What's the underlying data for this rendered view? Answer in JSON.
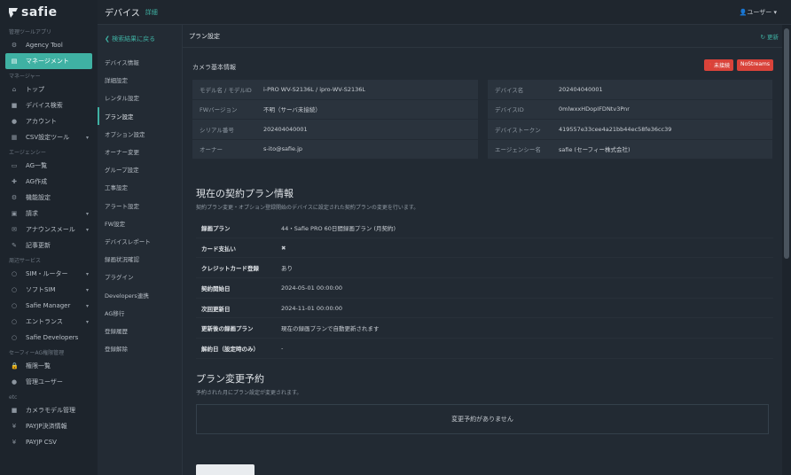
{
  "app": {
    "logo": "safie"
  },
  "sidebar": {
    "sections": [
      {
        "title": "管理ツールアプリ",
        "items": [
          {
            "label": "Agency Tool",
            "icon": "agency-icon",
            "arrow": false
          },
          {
            "label": "マネージメント",
            "icon": "management-icon",
            "arrow": false,
            "active": true
          }
        ]
      },
      {
        "title": "マネージャー",
        "items": [
          {
            "label": "トップ",
            "icon": "home-icon",
            "arrow": false
          },
          {
            "label": "デバイス検索",
            "icon": "camera-icon",
            "arrow": false
          },
          {
            "label": "アカウント",
            "icon": "user-icon",
            "arrow": false
          },
          {
            "label": "CSV設定ツール",
            "icon": "csv-icon",
            "arrow": true
          }
        ]
      },
      {
        "title": "エージェンシー",
        "items": [
          {
            "label": "AG一覧",
            "icon": "list-icon",
            "arrow": false
          },
          {
            "label": "AG作成",
            "icon": "plus-icon",
            "arrow": false
          },
          {
            "label": "機能設定",
            "icon": "gear-icon",
            "arrow": false
          },
          {
            "label": "請求",
            "icon": "invoice-icon",
            "arrow": true
          },
          {
            "label": "アナウンスメール",
            "icon": "mail-icon",
            "arrow": true
          },
          {
            "label": "記事更新",
            "icon": "edit-icon",
            "arrow": false
          }
        ]
      },
      {
        "title": "周辺サービス",
        "items": [
          {
            "label": "SIM・ルーター",
            "icon": "circle-icon",
            "arrow": true
          },
          {
            "label": "ソフトSIM",
            "icon": "circle-icon",
            "arrow": true
          },
          {
            "label": "Safie Manager",
            "icon": "circle-icon",
            "arrow": true
          },
          {
            "label": "エントランス",
            "icon": "circle-icon",
            "arrow": true
          },
          {
            "label": "Safie Developers",
            "icon": "circle-icon",
            "arrow": false
          }
        ]
      },
      {
        "title": "セーフィーAG権限管理",
        "items": [
          {
            "label": "権限一覧",
            "icon": "lock-icon",
            "arrow": false
          },
          {
            "label": "管理ユーザー",
            "icon": "user-icon",
            "arrow": false
          }
        ]
      },
      {
        "title": "etc",
        "items": [
          {
            "label": "カメラモデル管理",
            "icon": "camera-icon",
            "arrow": false
          },
          {
            "label": "PAYJP決済情報",
            "icon": "yen-icon",
            "arrow": false
          },
          {
            "label": "PAYJP CSV",
            "icon": "yen-icon",
            "arrow": false
          }
        ]
      }
    ]
  },
  "topbar": {
    "title": "デバイス",
    "subtitle": "詳細",
    "user": "ユーザー"
  },
  "subnav": {
    "back": "検索結果に戻る",
    "items": [
      "デバイス情報",
      "詳細設定",
      "レンタル設定",
      "プラン設定",
      "オプション設定",
      "オーナー変更",
      "グループ設定",
      "工事設定",
      "アラート設定",
      "FW設定",
      "デバイスレポート",
      "録画状況確認",
      "プラグイン",
      "Developers連携",
      "AG移行",
      "登録履歴",
      "登録解除"
    ],
    "active_index": 3
  },
  "main": {
    "header": "プラン設定",
    "refresh": "更新",
    "camera_title": "カメラ基本情報",
    "badges": [
      "未接続",
      "NoStreams"
    ],
    "left_info": [
      {
        "k": "モデル名 / モデルID",
        "v": "i-PRO WV-S2136L / ipro-WV-S2136L"
      },
      {
        "k": "FWバージョン",
        "v": "不明（サーバ未接続）"
      },
      {
        "k": "シリアル番号",
        "v": "202404040001"
      },
      {
        "k": "オーナー",
        "v": "s-ito@safie.jp"
      }
    ],
    "right_info": [
      {
        "k": "デバイス名",
        "v": "202404040001"
      },
      {
        "k": "デバイスID",
        "v": "0mlwxxHDopIFDNtv3Pnr"
      },
      {
        "k": "デバイストークン",
        "v": "419557e33cee4a21bb44ec58fe36cc39"
      },
      {
        "k": "エージェンシー名",
        "v": "safie (セーフィー株式会社)"
      }
    ],
    "contract": {
      "title": "現在の契約プラン情報",
      "subtitle": "契約プラン変更・オプション登録開始のデバイスに設定された契約プランの変更を行います。",
      "rows": [
        {
          "k": "録画プラン",
          "v": "44・Safie PRO 60日間録画プラン (月契約)"
        },
        {
          "k": "カード支払い",
          "v": "✖"
        },
        {
          "k": "クレジットカード登録",
          "v": "あり"
        },
        {
          "k": "契約開始日",
          "v": "2024-05-01 00:00:00"
        },
        {
          "k": "次回更新日",
          "v": "2024-11-01 00:00:00"
        },
        {
          "k": "更新後の録画プラン",
          "v": "現在の録画プランで自動更新されます"
        },
        {
          "k": "解約日（設定時のみ）",
          "v": "-"
        }
      ]
    },
    "reservation": {
      "title": "プラン変更予約",
      "subtitle": "予約された月にプラン設定が変更されます。",
      "empty": "変更予約がありません"
    }
  }
}
